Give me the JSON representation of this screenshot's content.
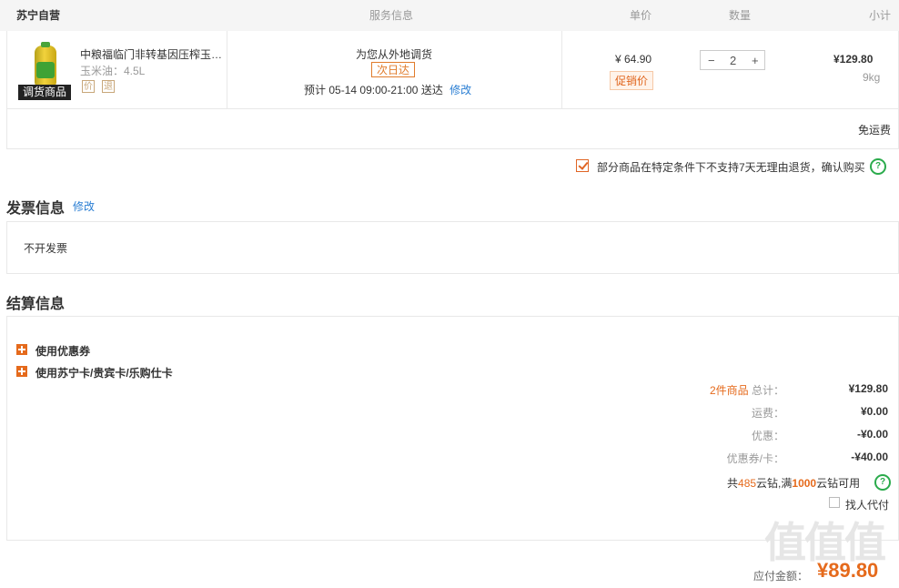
{
  "header": {
    "store": "苏宁自营",
    "service": "服务信息",
    "unit_price": "单价",
    "quantity": "数量",
    "subtotal": "小计"
  },
  "item": {
    "title": "中粮福临门非转基因压榨玉米油",
    "spec": "玉米油：4.5L",
    "tag": "调货商品",
    "badges": [
      "价",
      "退"
    ],
    "service_line": "为您从外地调货",
    "delivery_tag": "次日达",
    "eta_prefix": "预计",
    "eta_date": "05-14",
    "eta_time": "09:00-21:00",
    "eta_suffix": "送达",
    "eta_edit": "修改",
    "price": "¥ 64.90",
    "promo": "促销价",
    "qty": "2",
    "minus": "−",
    "plus": "+",
    "subtotal": "¥129.80",
    "weight": "9kg"
  },
  "shipping": {
    "free": "免运费"
  },
  "agreement": {
    "text": "部分商品在特定条件下不支持7天无理由退货，确认购买",
    "help": "?"
  },
  "invoice": {
    "title": "发票信息",
    "edit": "修改",
    "value": "不开发票"
  },
  "settlement": {
    "title": "结算信息",
    "coupon": "使用优惠券",
    "card": "使用苏宁卡/贵宾卡/乐购仕卡",
    "count_prefix": "2件商品",
    "total_label": "总计：",
    "total_value": "¥129.80",
    "freight_label": "运费：",
    "freight_value": "¥0.00",
    "discount_label": "优惠：",
    "discount_value": "-¥0.00",
    "voucher_label": "优惠券/卡：",
    "voucher_value": "-¥40.00",
    "diamond_prefix": "共",
    "diamond_count": "485",
    "diamond_mid": "云钻,满",
    "diamond_threshold": "1000",
    "diamond_suffix": "云钻可用",
    "proxy_pay": "找人代付",
    "payable_label": "应付金额：",
    "payable_value": "¥89.80"
  },
  "watermark": "值值值"
}
